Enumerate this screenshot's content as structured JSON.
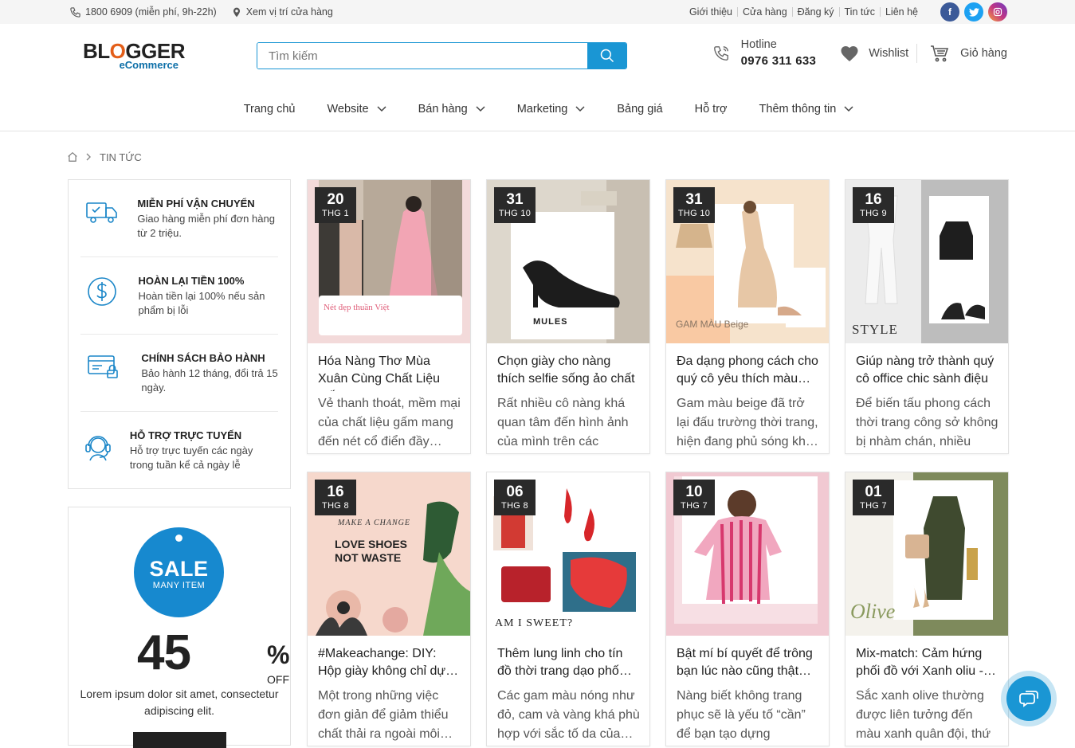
{
  "topbar": {
    "phone": "1800 6909 (miễn phí, 9h-22h)",
    "location": "Xem vị trí cửa hàng",
    "links": [
      "Giới thiệu",
      "Cửa hàng",
      "Đăng ký",
      "Tin tức",
      "Liên hệ"
    ],
    "social_colors": {
      "facebook": "#3b5998",
      "twitter": "#1da1f2",
      "instagram": "#c13584"
    }
  },
  "header": {
    "logo_top": "BLOGGER",
    "logo_bottom": "eCommerce",
    "search_placeholder": "Tìm kiếm",
    "hotline_label": "Hotline",
    "hotline_number": "0976 311 633",
    "wishlist": "Wishlist",
    "cart": "Giỏ hàng"
  },
  "nav": [
    {
      "label": "Trang chủ",
      "dropdown": false
    },
    {
      "label": "Website",
      "dropdown": true
    },
    {
      "label": "Bán hàng",
      "dropdown": true
    },
    {
      "label": "Marketing",
      "dropdown": true
    },
    {
      "label": "Bảng giá",
      "dropdown": false
    },
    {
      "label": "Hỗ trợ",
      "dropdown": false
    },
    {
      "label": "Thêm thông tin",
      "dropdown": true
    }
  ],
  "breadcrumb": {
    "current": "TIN TỨC"
  },
  "services": [
    {
      "icon": "truck-icon",
      "title": "MIỄN PHÍ VẬN CHUYỂN",
      "desc": "Giao hàng miễn phí đơn hàng từ 2 triệu."
    },
    {
      "icon": "dollar-icon",
      "title": "HOÀN LẠI TIỀN 100%",
      "desc": "Hoàn tiền lại 100% nếu sản phẩm bị lỗi"
    },
    {
      "icon": "card-lock-icon",
      "title": "CHÍNH SÁCH BẢO HÀNH",
      "desc": "Bảo hành 12 tháng, đổi trả 15 ngày."
    },
    {
      "icon": "headset-icon",
      "title": "HỖ TRỢ TRỰC TUYẾN",
      "desc": "Hỗ trợ trực tuyến các ngày trong tuần kể cả ngày lễ"
    }
  ],
  "sale": {
    "word": "SALE",
    "sub": "MANY ITEM",
    "number": "45",
    "percent": "%",
    "off": "OFF",
    "desc": "Lorem ipsum dolor sit amet, consectetur adipiscing elit.",
    "accent": "#1789cf"
  },
  "posts": [
    {
      "day": "20",
      "month": "THG 1",
      "title": "Hóa Nàng Thơ Mùa Xuân Cùng Chất Liệu Gấm…",
      "desc": "Vẻ thanh thoát, mềm mại của chất liệu gấm mang đến nét cổ điển đầy…",
      "bg": "#f3dada"
    },
    {
      "day": "31",
      "month": "THG 10",
      "title": "Chọn giày cho nàng thích selfie sống ảo chất",
      "desc": "Rất nhiều cô nàng khá quan tâm đến hình ảnh của mình trên các trang…",
      "bg": "#e9e4dc"
    },
    {
      "day": "31",
      "month": "THG 10",
      "title": "Đa dạng phong cách cho quý cô yêu thích màu…",
      "desc": "Gam màu beige đã trở lại đấu trường thời trang, hiện đang phủ sóng kh…",
      "bg": "#f6e3cc"
    },
    {
      "day": "16",
      "month": "THG 9",
      "title": "Giúp nàng trở thành quý cô office chic sành điệu",
      "desc": "Để biến tấu phong cách thời trang công sở không bị nhàm chán, nhiều cô…",
      "bg": "#dcdcdc"
    },
    {
      "day": "16",
      "month": "THG 8",
      "title": "#Makeachange: DIY: Hộp giày không chỉ dự…",
      "desc": "Một trong những việc đơn giản để giảm thiểu chất thải ra ngoài môi…",
      "bg": "#f6d8cc"
    },
    {
      "day": "06",
      "month": "THG 8",
      "title": "Thêm lung linh cho tín đồ thời trang dạo phố…",
      "desc": "Các gam màu nóng như đỏ, cam và vàng khá phù hợp với sắc tố da của…",
      "bg": "#ffffff"
    },
    {
      "day": "10",
      "month": "THG 7",
      "title": "Bật mí bí quyết để trông bạn lúc nào cũng thật…",
      "desc": "Nàng biết không trang phục sẽ là yếu tố “cần” để bạn tạo dựng phong…",
      "bg": "#f1c9d2"
    },
    {
      "day": "01",
      "month": "THG 7",
      "title": "Mix-match: Cảm hứng phối đồ với Xanh oliu -…",
      "desc": "Sắc xanh olive thường được liên tưởng đến màu xanh quân đội, thứ màu…",
      "bg": "#f4f2ec"
    }
  ],
  "thumb_texts": {
    "p1": "Nét đẹp thuần Việt",
    "p2": "MULES",
    "p3": "GAM MÀU Beige",
    "p4": "STYLE",
    "p5a": "MAKE A CHANGE",
    "p5b": "LOVE SHOES",
    "p5c": "NOT WASTE",
    "p6": "AM I SWEET?",
    "p8": "Olive"
  }
}
